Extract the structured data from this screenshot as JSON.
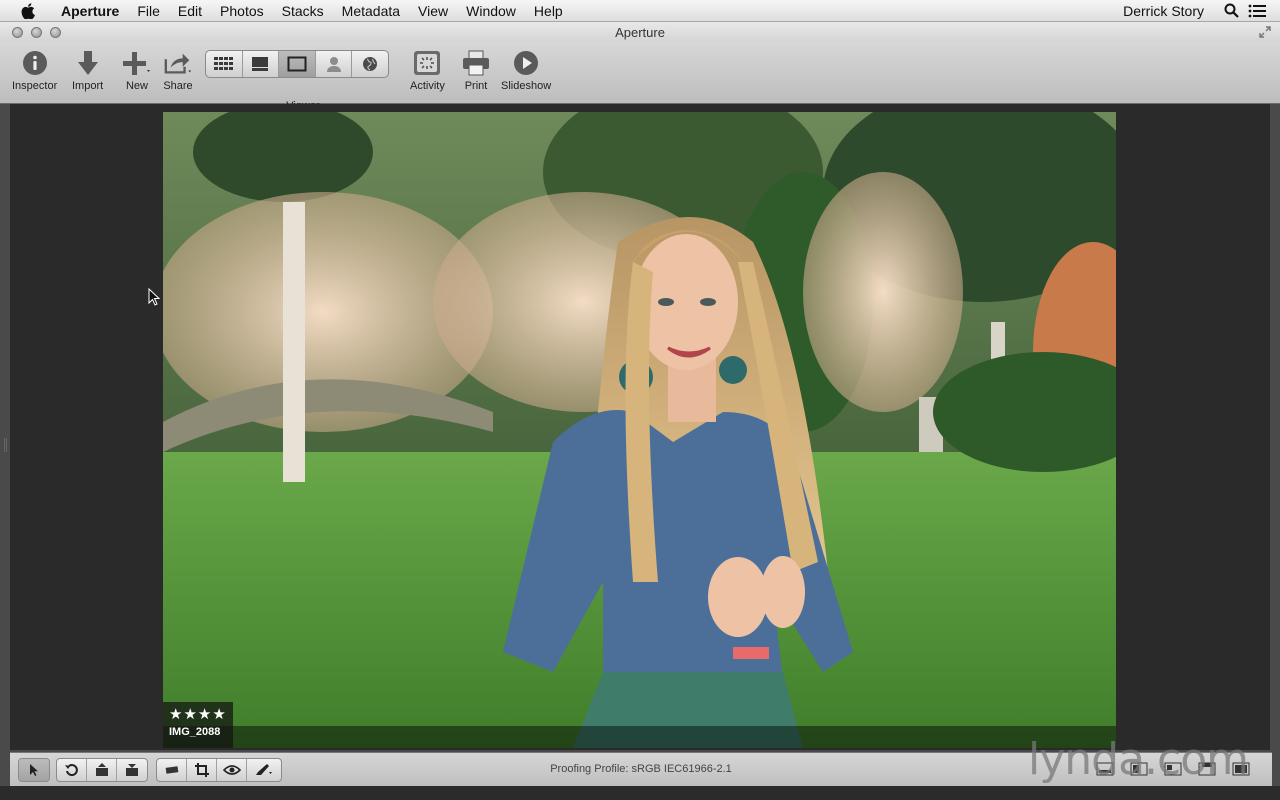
{
  "menubar": {
    "apple_icon": "apple-icon",
    "app_name": "Aperture",
    "items": [
      "File",
      "Edit",
      "Photos",
      "Stacks",
      "Metadata",
      "View",
      "Window",
      "Help"
    ],
    "user": "Derrick Story"
  },
  "window": {
    "title": "Aperture"
  },
  "toolbar": {
    "inspector": "Inspector",
    "import": "Import",
    "new": "New",
    "share": "Share",
    "viewer": "Viewer",
    "activity": "Activity",
    "print": "Print",
    "slideshow": "Slideshow",
    "viewer_modes": [
      "grid",
      "filmstrip",
      "viewer",
      "faces",
      "places"
    ],
    "viewer_active": "viewer"
  },
  "photo": {
    "rating": "★★★★",
    "stars": 4,
    "filename": "IMG_2088"
  },
  "bottombar": {
    "proofing": "Proofing Profile: sRGB IEC61966-2.1"
  },
  "watermark": "lynda.com"
}
